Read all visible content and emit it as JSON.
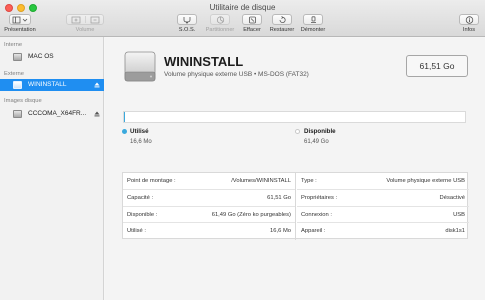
{
  "window": {
    "title": "Utilitaire de disque"
  },
  "toolbar": {
    "presentation_label": "Présentation",
    "volume_label": "Volume",
    "first_aid_label": "S.O.S.",
    "partition_label": "Partitionner",
    "erase_label": "Effacer",
    "restore_label": "Restaurer",
    "unmount_label": "Démonter",
    "info_label": "Infos"
  },
  "sidebar": {
    "sections": [
      {
        "heading": "Interne",
        "items": [
          {
            "label": "MAC OS",
            "icon": "internal-disk-icon",
            "selected": false
          }
        ]
      },
      {
        "heading": "Externe",
        "items": [
          {
            "label": "WININSTALL",
            "icon": "external-disk-icon",
            "selected": true
          }
        ]
      },
      {
        "heading": "Images disque",
        "items": [
          {
            "label": "CCCOMA_X64FR...",
            "icon": "disk-image-icon",
            "selected": false
          }
        ]
      }
    ]
  },
  "volume": {
    "name": "WININSTALL",
    "description": "Volume physique externe USB • MS-DOS (FAT32)",
    "size": "61,51 Go"
  },
  "usage": {
    "used_fraction": 0.0003,
    "used_label": "Utilisé",
    "used_value": "16,6 Mo",
    "used_color": "#3aa9dd",
    "free_label": "Disponible",
    "free_value": "61,49 Go",
    "free_color": "#ffffff"
  },
  "info": {
    "left": [
      {
        "key": "Point de montage :",
        "value": "/Volumes/WININSTALL"
      },
      {
        "key": "Capacité :",
        "value": "61,51 Go"
      },
      {
        "key": "Disponible :",
        "value": "61,49 Go (Zéro ko purgeables)"
      },
      {
        "key": "Utilisé :",
        "value": "16,6 Mo"
      }
    ],
    "right": [
      {
        "key": "Type :",
        "value": "Volume physique externe USB"
      },
      {
        "key": "Propriétaires :",
        "value": "Désactivé"
      },
      {
        "key": "Connexion :",
        "value": "USB"
      },
      {
        "key": "Appareil :",
        "value": "disk1s1"
      }
    ]
  }
}
